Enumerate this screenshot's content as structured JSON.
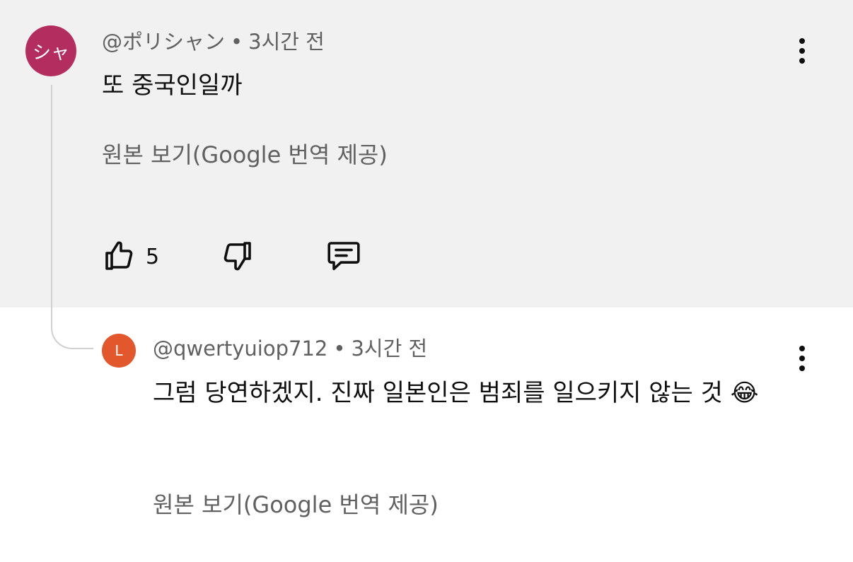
{
  "comment": {
    "avatar_text": "シャ",
    "author": "@ポリシャン",
    "separator": "•",
    "time": "3시간 전",
    "text": "또 중국인일까",
    "translate_link": "원본 보기(Google 번역 제공)",
    "like_count": "5",
    "avatar_color": "#b32d5e",
    "icons": [
      "thumbs-up-icon",
      "thumbs-down-icon",
      "reply-icon",
      "more-vert-icon"
    ]
  },
  "reply": {
    "avatar_text": "L",
    "author": "@qwertyuiop712",
    "separator": "•",
    "time": "3시간 전",
    "text": "그럼 당연하겠지. 진짜 일본인은 범죄를 일으키지 않는 것 😂",
    "translate_link": "원본 보기(Google 번역 제공)",
    "avatar_color": "#e2572b",
    "icons": [
      "more-vert-icon"
    ]
  },
  "colors": {
    "highlight_background": "#f1f1f1",
    "secondary_text": "#606060",
    "primary_text": "#0f0f0f"
  }
}
